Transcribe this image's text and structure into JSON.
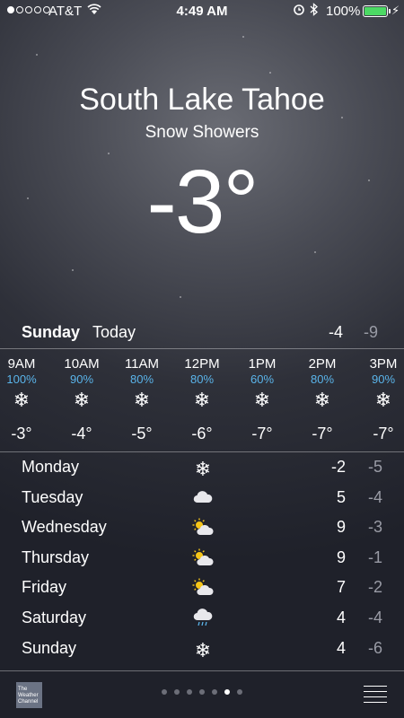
{
  "status_bar": {
    "carrier": "AT&T",
    "time": "4:49 AM",
    "battery": "100%",
    "signal_bars": 1,
    "battery_color": "#4cd964"
  },
  "location": {
    "city": "South Lake Tahoe",
    "condition": "Snow Showers",
    "temperature": "-3°"
  },
  "today": {
    "day": "Sunday",
    "label": "Today",
    "high": "-4",
    "low": "-9"
  },
  "hourly": [
    {
      "time": "9AM",
      "precip": "100%",
      "icon": "snowflake",
      "temp": "-3°"
    },
    {
      "time": "10AM",
      "precip": "90%",
      "icon": "snowflake",
      "temp": "-4°"
    },
    {
      "time": "11AM",
      "precip": "80%",
      "icon": "snowflake",
      "temp": "-5°"
    },
    {
      "time": "12PM",
      "precip": "80%",
      "icon": "snowflake",
      "temp": "-6°"
    },
    {
      "time": "1PM",
      "precip": "60%",
      "icon": "snowflake",
      "temp": "-7°"
    },
    {
      "time": "2PM",
      "precip": "80%",
      "icon": "snowflake",
      "temp": "-7°"
    },
    {
      "time": "3PM",
      "precip": "90%",
      "icon": "snowflake",
      "temp": "-7°"
    }
  ],
  "daily": [
    {
      "day": "Monday",
      "icon": "snowflake",
      "high": "-2",
      "low": "-5"
    },
    {
      "day": "Tuesday",
      "icon": "cloud",
      "high": "5",
      "low": "-4"
    },
    {
      "day": "Wednesday",
      "icon": "partly-sunny",
      "high": "9",
      "low": "-3"
    },
    {
      "day": "Thursday",
      "icon": "partly-sunny",
      "high": "9",
      "low": "-1"
    },
    {
      "day": "Friday",
      "icon": "partly-sunny",
      "high": "7",
      "low": "-2"
    },
    {
      "day": "Saturday",
      "icon": "rain-cloud",
      "high": "4",
      "low": "-4"
    },
    {
      "day": "Sunday",
      "icon": "snowflake",
      "high": "4",
      "low": "-6"
    }
  ],
  "bottom_bar": {
    "logo_text": "The Weather Channel",
    "page_count": 7,
    "active_page": 6
  },
  "colors": {
    "precip": "#5ab4ea",
    "low_temp": "#9a9ca6"
  }
}
